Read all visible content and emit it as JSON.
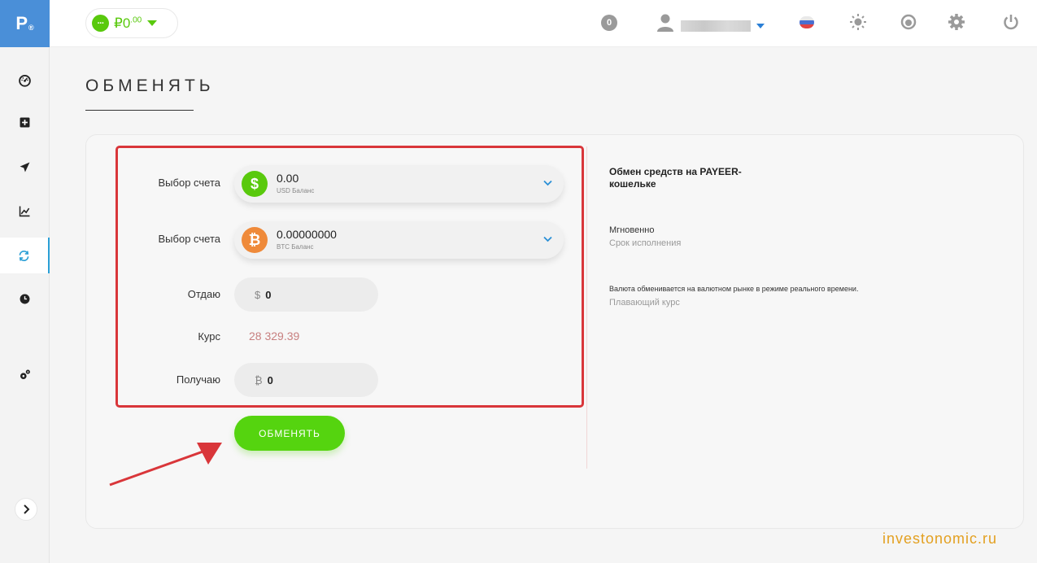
{
  "logo": {
    "text": "P",
    "reg": "®"
  },
  "sidebar": {
    "items": [
      {
        "name": "dashboard",
        "icon": "gauge-icon"
      },
      {
        "name": "deposit",
        "icon": "plus-square-icon"
      },
      {
        "name": "send",
        "icon": "paper-plane-icon"
      },
      {
        "name": "trade",
        "icon": "chart-icon"
      },
      {
        "name": "exchange",
        "icon": "exchange-icon",
        "active": true
      },
      {
        "name": "history",
        "icon": "clock-icon"
      },
      {
        "name": "settings",
        "icon": "gears-icon"
      }
    ]
  },
  "header": {
    "balance": {
      "currency": "₽",
      "value": "0",
      "cents": ".00"
    },
    "notifications": "0"
  },
  "page": {
    "title": "ОБМЕНЯТЬ"
  },
  "form": {
    "from_label": "Выбор счета",
    "from_value": "0.00",
    "from_sub": "USD Баланс",
    "to_label": "Выбор счета",
    "to_value": "0.00000000",
    "to_sub": "BTC Баланс",
    "give_label": "Отдаю",
    "give_currency": "$",
    "give_value": "0",
    "rate_label": "Курс",
    "rate_value": "28 329.39",
    "receive_label": "Получаю",
    "receive_currency": "₿",
    "receive_value": "0",
    "submit_label": "ОБМЕНЯТЬ"
  },
  "info": {
    "title": "Обмен средств на PAYEER-кошельке",
    "speed": "Мгновенно",
    "speed_sub": "Срок исполнения",
    "note": "Валюта обменивается на валютном рынке в режиме реального времени.",
    "note_sub": "Плавающий курс"
  },
  "colors": {
    "accent_green": "#55d40f",
    "red_box": "#d9363a",
    "btc_orange": "#ef8a3a",
    "logo_blue": "#4a8fd8"
  },
  "watermark": "investonomic.ru"
}
